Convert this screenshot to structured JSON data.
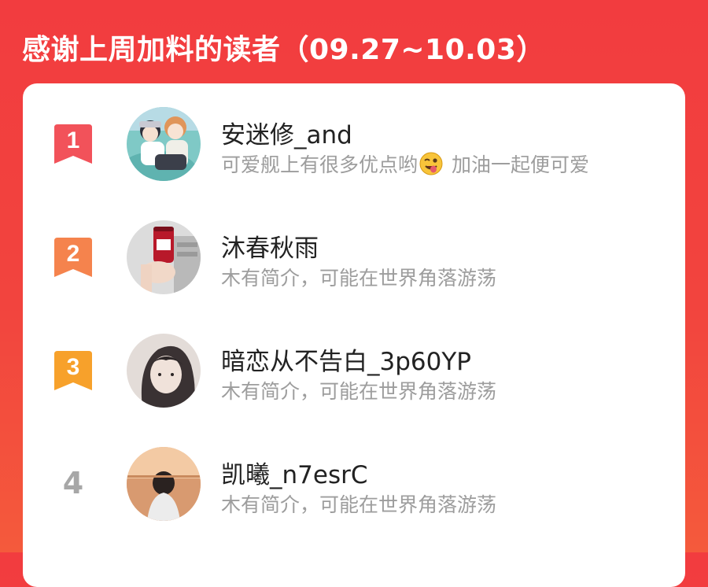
{
  "header": {
    "title": "感谢上周加料的读者（09.27~10.03）"
  },
  "colors": {
    "background": "#f23c3f",
    "rank1": "#f2525a",
    "rank2": "#f5834d",
    "rank3": "#f7a12b",
    "rank_plain": "#a7a7a7"
  },
  "readers": [
    {
      "rank": "1",
      "name": "安迷修_and",
      "bio_before_emoji": "可爱舰上有很多优点哟",
      "emoji": "winking-tongue-face-emoji",
      "bio_after_emoji": " 加油一起便可爱"
    },
    {
      "rank": "2",
      "name": "沐春秋雨",
      "bio": "木有简介，可能在世界角落游荡"
    },
    {
      "rank": "3",
      "name": "暗恋从不告白_3p60YP",
      "bio": "木有简介，可能在世界角落游荡"
    },
    {
      "rank": "4",
      "name": "凯曦_n7esrC",
      "bio": "木有简介，可能在世界角落游荡"
    }
  ]
}
